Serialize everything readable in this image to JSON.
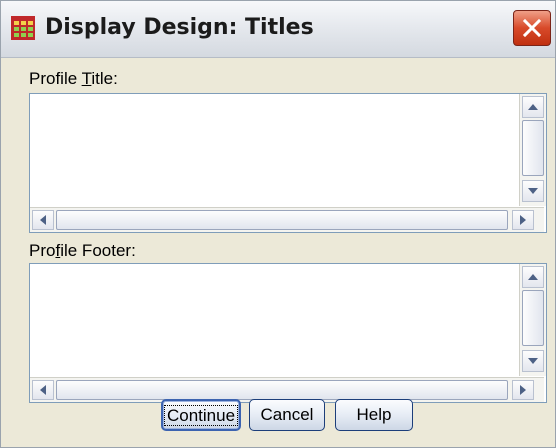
{
  "window": {
    "title": "Display Design: Titles"
  },
  "profile_title": {
    "label_before": "Profile ",
    "label_accel": "T",
    "label_after": "itle:",
    "value": ""
  },
  "profile_footer": {
    "label_before": "Pro",
    "label_accel": "f",
    "label_after": "ile Footer:",
    "value": ""
  },
  "buttons": {
    "continue": "Continue",
    "cancel": "Cancel",
    "help": "Help"
  }
}
